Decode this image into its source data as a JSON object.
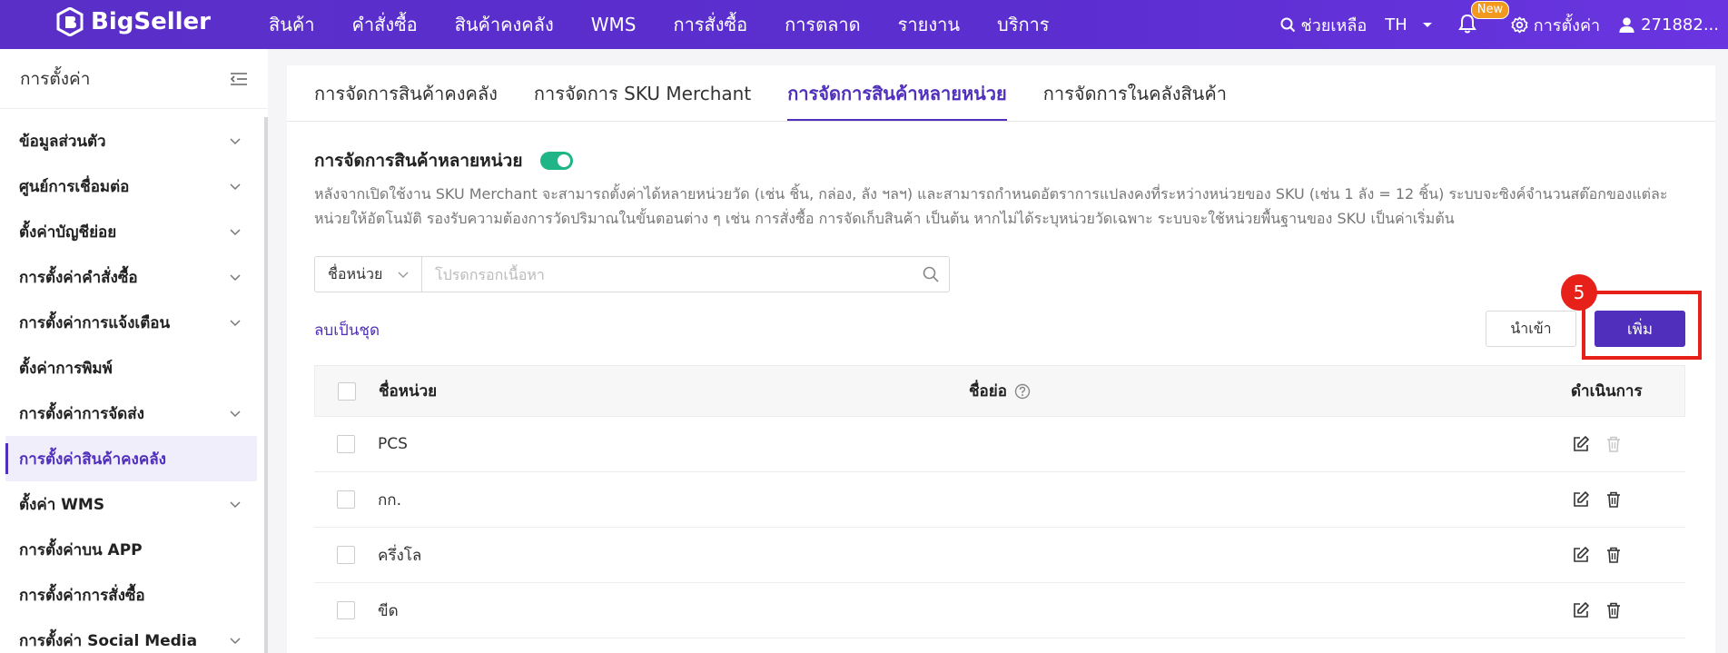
{
  "brand": {
    "name": "BigSeller"
  },
  "nav": {
    "items": [
      "สินค้า",
      "คำสั่งซื้อ",
      "สินค้าคงคลัง",
      "WMS",
      "การสั่งซื้อ",
      "การตลาด",
      "รายงาน",
      "บริการ"
    ]
  },
  "topright": {
    "help": "ช่วยเหลือ",
    "lang": "TH",
    "new_badge": "New",
    "settings": "การตั้งค่า",
    "user": "271882..."
  },
  "sidebar": {
    "title": "การตั้งค่า",
    "items": [
      {
        "label": "ข้อมูลส่วนตัว",
        "expandable": true
      },
      {
        "label": "ศูนย์การเชื่อมต่อ",
        "expandable": true
      },
      {
        "label": "ตั้งค่าบัญชีย่อย",
        "expandable": true
      },
      {
        "label": "การตั้งค่าคำสั่งซื้อ",
        "expandable": true
      },
      {
        "label": "การตั้งค่าการแจ้งเตือน",
        "expandable": true
      },
      {
        "label": "ตั้งค่าการพิมพ์",
        "expandable": false
      },
      {
        "label": "การตั้งค่าการจัดส่ง",
        "expandable": true
      },
      {
        "label": "การตั้งค่าสินค้าคงคลัง",
        "expandable": false,
        "active": true
      },
      {
        "label": "ตั้งค่า WMS",
        "expandable": true
      },
      {
        "label": "การตั้งค่าบน APP",
        "expandable": false
      },
      {
        "label": "การตั้งค่าการสั่งซื้อ",
        "expandable": false
      },
      {
        "label": "การตั้งค่า Social Media",
        "expandable": true
      }
    ]
  },
  "tabs": [
    {
      "label": "การจัดการสินค้าคงคลัง"
    },
    {
      "label": "การจัดการ SKU Merchant"
    },
    {
      "label": "การจัดการสินค้าหลายหน่วย",
      "active": true
    },
    {
      "label": "การจัดการในคลังสินค้า"
    }
  ],
  "section": {
    "title": "การจัดการสินค้าหลายหน่วย",
    "toggle_on": true,
    "description": "หลังจากเปิดใช้งาน SKU Merchant จะสามารถตั้งค่าได้หลายหน่วยวัด (เช่น ชิ้น, กล่อง, ลัง ฯลฯ) และสามารถกำหนดอัตราการแปลงคงที่ระหว่างหน่วยของ SKU (เช่น 1 ลัง = 12 ชิ้น) ระบบจะซิงค์จำนวนสต๊อกของแต่ละหน่วยให้อัตโนมัติ รองรับความต้องการวัดปริมาณในขั้นตอนต่าง ๆ เช่น การสั่งซื้อ การจัดเก็บสินค้า เป็นต้น หากไม่ได้ระบุหน่วยวัดเฉพาะ ระบบจะใช้หน่วยพื้นฐานของ SKU เป็นค่าเริ่มต้น"
  },
  "search": {
    "select_value": "ชื่อหน่วย",
    "placeholder": "โปรดกรอกเนื้อหา"
  },
  "actions": {
    "bulk_delete": "ลบเป็นชุด",
    "import": "นำเข้า",
    "add": "เพิ่ม",
    "step_number": "5"
  },
  "table": {
    "headers": {
      "name": "ชื่อหน่วย",
      "short": "ชื่อย่อ",
      "action": "ดำเนินการ"
    },
    "rows": [
      {
        "name": "PCS",
        "short": "",
        "delete_enabled": false
      },
      {
        "name": "กก.",
        "short": "",
        "delete_enabled": true
      },
      {
        "name": "ครึ่งโล",
        "short": "",
        "delete_enabled": true
      },
      {
        "name": "ขีด",
        "short": "",
        "delete_enabled": true
      }
    ]
  },
  "colors": {
    "brand_purple": "#4f2fbb",
    "topbar": "#5a2fc8",
    "toggle_green": "#1fb587",
    "highlight_red": "#e8201a",
    "new_badge_orange": "#f39a1e"
  }
}
